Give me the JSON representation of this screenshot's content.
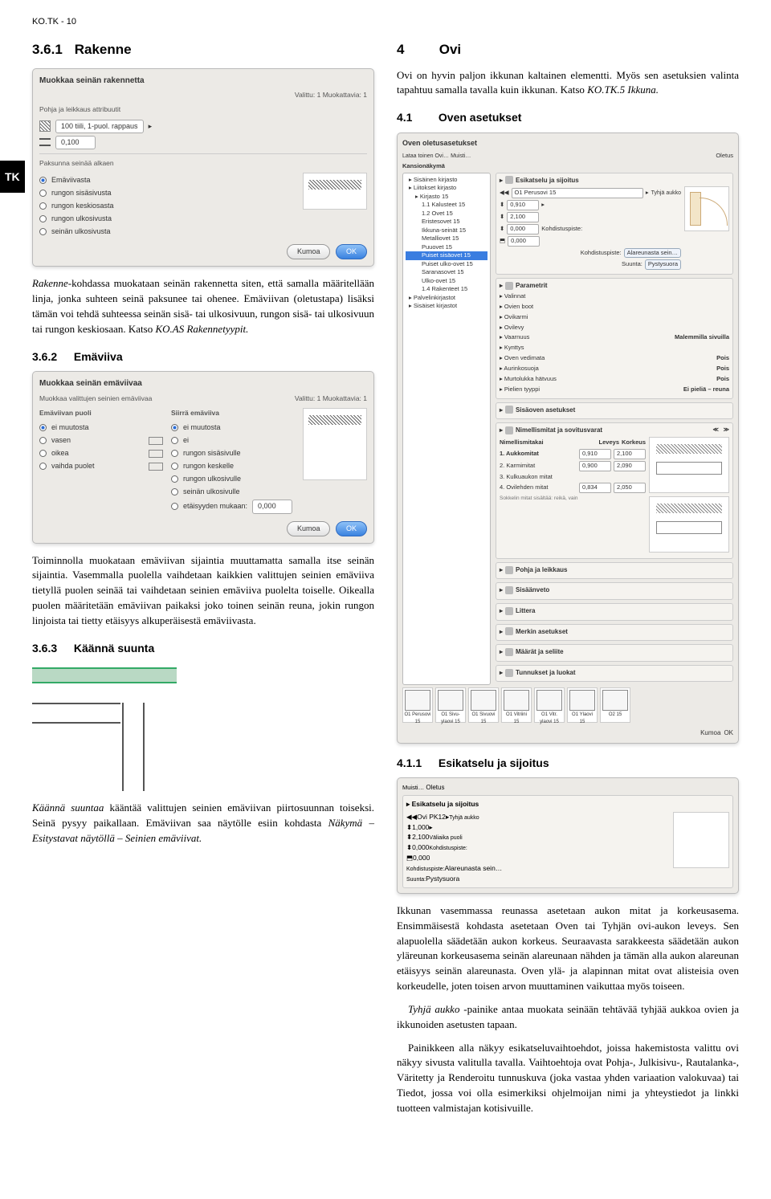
{
  "header": "KO.TK - 10",
  "tab": "TK",
  "left": {
    "h361_num": "3.6.1",
    "h361_title": "Rakenne",
    "dlg1": {
      "title": "Muokkaa seinän rakennetta",
      "selected": "Valittu: 1 Muokattavia: 1",
      "subtitle": "Pohja ja leikkaus attribuutit",
      "field1": "100 tiili, 1-puol. rappaus",
      "field2": "0,100",
      "subtitle2": "Paksunna seinää alkaen",
      "r1": "Emäviivasta",
      "r2": "rungon sisäsivusta",
      "r3": "rungon keskiosasta",
      "r4": "rungon ulkosivusta",
      "r5": "seinän ulkosivusta",
      "cancel": "Kumoa",
      "ok": "OK"
    },
    "p1a": "Rakenne",
    "p1b": "-kohdassa muokataan seinän rakennetta siten, että samalla määritellään linja, jonka suhteen seinä paksunee tai ohenee. Emäviivan (oletustapa) lisäksi tämän voi tehdä suhteessa seinän sisä- tai ulkosivuun, rungon sisä- tai ulkosivuun tai rungon keskiosaan. Katso ",
    "p1c": "KO.AS Rakennetyypit.",
    "h362_num": "3.6.2",
    "h362_title": "Emäviiva",
    "dlg2": {
      "title": "Muokkaa seinän emäviivaa",
      "subtitle": "Muokkaa valittujen seinien emäviivaa",
      "selected": "Valittu: 1 Muokattavia: 1",
      "colA": "Emäviivan puoli",
      "colB": "Siirrä emäviiva",
      "a1": "ei muutosta",
      "a2": "vasen",
      "a3": "oikea",
      "a4": "vaihda puolet",
      "b1": "ei muutosta",
      "b2": "ei",
      "b3": "rungon sisäsivulle",
      "b4": "rungon keskelle",
      "b5": "rungon ulkosivulle",
      "b6": "seinän ulkosivulle",
      "b7": "etäisyyden mukaan:",
      "dist": "0,000",
      "cancel": "Kumoa",
      "ok": "OK"
    },
    "p2": "Toiminnolla muokataan emäviivan sijaintia muuttamatta samalla itse seinän sijaintia. Vasemmalla puolella vaihdetaan kaikkien valittujen seinien emäviiva tietyllä puolen seinää tai vaihdetaan seinien emäviiva puolelta toiselle. Oikealla puolen määritetään emäviivan paikaksi joko toinen seinän reuna, jokin rungon linjoista tai tietty etäisyys alkuperäisestä emäviivasta.",
    "h363_num": "3.6.3",
    "h363_title": "Käännä suunta",
    "p3a": "Käännä suuntaa",
    "p3b": " kääntää valittujen seinien emäviivan piirtosuunnan toiseksi. Seinä pysyy paikallaan. Emäviivan saa näytölle esiin kohdasta ",
    "p3c": "Näkymä – Esitystavat näytöllä – Seinien emäviivat."
  },
  "right": {
    "h4_num": "4",
    "h4_title": "Ovi",
    "p4a": "Ovi on hyvin paljon ikkunan kaltainen elementti. Myös sen asetuksien valinta tapahtuu samalla tavalla kuin ikkunan. Katso ",
    "p4b": "KO.TK.5 Ikkuna.",
    "h41_num": "4.1",
    "h41_title": "Oven asetukset",
    "big": {
      "title": "Oven oletusasetukset",
      "status": "Oletus",
      "load": "Lataa toinen Ovi…",
      "save": "Muisti…",
      "navtitle": "Kansionäkymä",
      "tree": [
        {
          "lvl": 1,
          "t": "Sisäinen kirjasto"
        },
        {
          "lvl": 1,
          "t": "Liitokset kirjasto"
        },
        {
          "lvl": 2,
          "t": "Kirjasto 15"
        },
        {
          "lvl": 3,
          "t": "1.1 Kalusteet 15"
        },
        {
          "lvl": 3,
          "t": "1.2 Ovet 15"
        },
        {
          "lvl": 3,
          "t": "Eristesovet 15"
        },
        {
          "lvl": 3,
          "t": "Ikkuna-seinät 15"
        },
        {
          "lvl": 3,
          "t": "Metalliovet 15"
        },
        {
          "lvl": 3,
          "t": "Puuovet 15"
        },
        {
          "lvl": 3,
          "t": "Puiset sisäovet 15",
          "sel": true
        },
        {
          "lvl": 3,
          "t": "Puiset ulko-ovet 15"
        },
        {
          "lvl": 3,
          "t": "Saranasovet 15"
        },
        {
          "lvl": 3,
          "t": "Ulko-ovet 15"
        },
        {
          "lvl": 3,
          "t": "1.4 Rakenteet 15"
        },
        {
          "lvl": 1,
          "t": "Palvelinkirjastot"
        },
        {
          "lvl": 1,
          "t": "Sisäiset kirjastot"
        }
      ],
      "panel1": "Esikatselu ja sijoitus",
      "rowSelect": "O1 Perusovi 15",
      "empty": "Tyhjä aukko",
      "v1": "0,910",
      "v2": "2,100",
      "v3": "0,000",
      "v4": "0,000",
      "kohde": "Kohdistuspiste:",
      "kp1": "Alareunasta sein…",
      "kp2": "Pystysuora",
      "panel2": "Parametrit",
      "params": [
        "Valinnat",
        "Ovien boot",
        "Ovikarmi",
        "Ovilevy",
        "Vaarnuus",
        "Kynttys",
        "Oven vedimata",
        "Aurinkosuoja",
        "Murtolukka hätvuus",
        "Pielien tyyppi"
      ],
      "paramR1": "Malemmilla sivuilla",
      "paramR2": "Pois",
      "paramR3": "Pois",
      "paramR4": "Pois",
      "paramR5": "Ei pieliä – reuna",
      "panel3": "Sisäoven asetukset",
      "panel4": "Nimellismitat ja sovitusvarat",
      "th1": "Nimellismitakai",
      "th2": "Leveys",
      "th3": "Korkeus",
      "tr1": "1. Aukkomitat",
      "c11": "0,910",
      "c12": "2,100",
      "tr2": "2. Karmimitat",
      "c21": "0,900",
      "c22": "2,090",
      "tr3": "3. Kulkuaukon mitat",
      "tr4": "4. Ovilehden mitat",
      "c41": "0,834",
      "c42": "2,050",
      "note": "Sokkelin mitat sisältää: reikä, vain",
      "thumbs": [
        "O1 Perusovi 15",
        "O1 Sivu-ylaovi 15",
        "O1 Sivuovi 15",
        "O1 Vitriini 15",
        "O1 Vitr. ylaovi 15",
        "O1 Ylaovi 15",
        "O2 15"
      ],
      "list": [
        "Pohja ja leikkaus",
        "Sisäänveto",
        "Littera",
        "Merkin asetukset",
        "Määrät ja seliite",
        "Tunnukset ja luokat"
      ],
      "cancel": "Kumoa",
      "ok": "OK"
    },
    "h411_num": "4.1.1",
    "h411_title": "Esikatselu ja sijoitus",
    "mini": {
      "save": "Muisti…",
      "status": "Oletus",
      "panel": "Esikatselu ja sijoitus",
      "sel": "Ovi PK12",
      "empty": "Tyhjä aukko",
      "v1": "1,000",
      "v2": "2,100",
      "v3": "0,000",
      "v4": "0,000",
      "lbl": "Väliaika puoli",
      "kohde": "Kohdistuspiste:",
      "kp1": "Alareunasta sein…",
      "kp2label": "Suunta:",
      "kp2": "Pystysuora"
    },
    "p5": "Ikkunan vasemmassa reunassa asetetaan aukon mitat ja korkeusasema. Ensimmäisestä kohdasta asetetaan Oven tai Tyhjän ovi-aukon leveys. Sen alapuolella säädetään aukon korkeus. Seuraavasta sarakkeesta säädetään aukon yläreunan korkeusasema seinän alareunaan nähden ja tämän alla aukon alareunan etäisyys seinän alareunasta. Oven ylä- ja alapinnan mitat ovat alisteisia oven korkeudelle, joten toisen arvon muuttaminen vaikuttaa myös toiseen.",
    "p6a": "Tyhjä aukko",
    "p6b": " -painike antaa muokata seinään tehtävää tyhjää aukkoa ovien ja ikkunoiden asetusten tapaan.",
    "p7": "Painikkeen alla näkyy esikatseluvaihtoehdot, joissa hakemistosta valittu ovi näkyy sivusta valitulla tavalla. Vaihtoehtoja ovat Pohja-, Julkisivu-, Rautalanka-, Väritetty ja Renderoitu tunnuskuva (joka vastaa yhden variaation valokuvaa) tai Tiedot, jossa voi olla esimerkiksi ohjelmoijan nimi ja yhteystiedot ja linkki tuotteen valmistajan kotisivuille."
  }
}
